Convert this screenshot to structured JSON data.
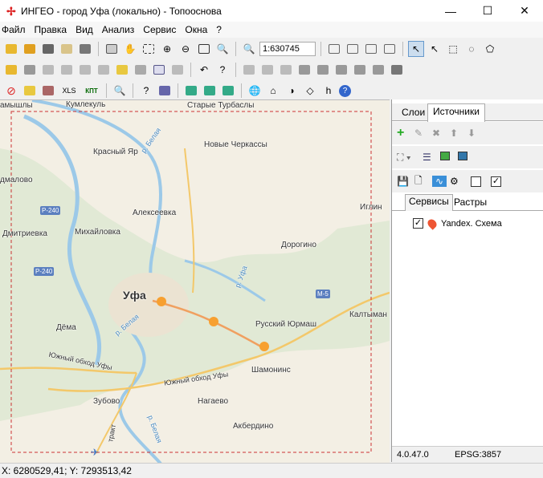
{
  "window": {
    "title": "ИНГЕО - город Уфа (локально) - Топооснова",
    "minimize": "—",
    "maximize": "☐",
    "close": "✕"
  },
  "menu": [
    "Файл",
    "Правка",
    "Вид",
    "Анализ",
    "Сервис",
    "Окна",
    "?"
  ],
  "toolbar": {
    "scale": "1:630745",
    "xls": "XLS",
    "kpt": "КПТ"
  },
  "map": {
    "labels": {
      "kumlekul": "Кумлекуль",
      "turbasly": "Старые Турбаслы",
      "kamyshly": "амышлы",
      "krasny_yar": "Красный Яр",
      "novye_cherkassy": "Новые Черкассы",
      "dmalovo": "дмалово",
      "alekseevka": "Алексеевка",
      "iglin": "Иглин",
      "dmitrievka": "Дмитриевка",
      "mikhaylovka": "Михайловка",
      "dorogino": "Дорогино",
      "ufa": "Уфа",
      "kaltymano": "Калтыман",
      "dema": "Дёма",
      "russky_yurmash": "Русский Юрмаш",
      "yuzhny1": "Южный обход Уфы",
      "yuzhny2": "Южный обход Уфы",
      "shamonino": "Шамонинс",
      "zubovo": "Зубово",
      "nagaevo": "Нагаево",
      "akberdino": "Акбердино",
      "belaya1": "р. Белая",
      "belaya2": "р. Белая",
      "belaya3": "р. Белая",
      "ufa_river": "р. Уфа",
      "trakt": "тракт",
      "r240a": "Р-240",
      "r240b": "Р-240",
      "m5": "М-5"
    }
  },
  "panel": {
    "tabs": [
      "Слои",
      "Источники"
    ],
    "sub_tabs": [
      "Сервисы",
      "Растры"
    ],
    "source_item": "Yandex. Схема",
    "version": "4.0.47.0",
    "epsg": "EPSG:3857"
  },
  "status": {
    "coords": "X: 6280529,41; Y: 7293513,42"
  }
}
